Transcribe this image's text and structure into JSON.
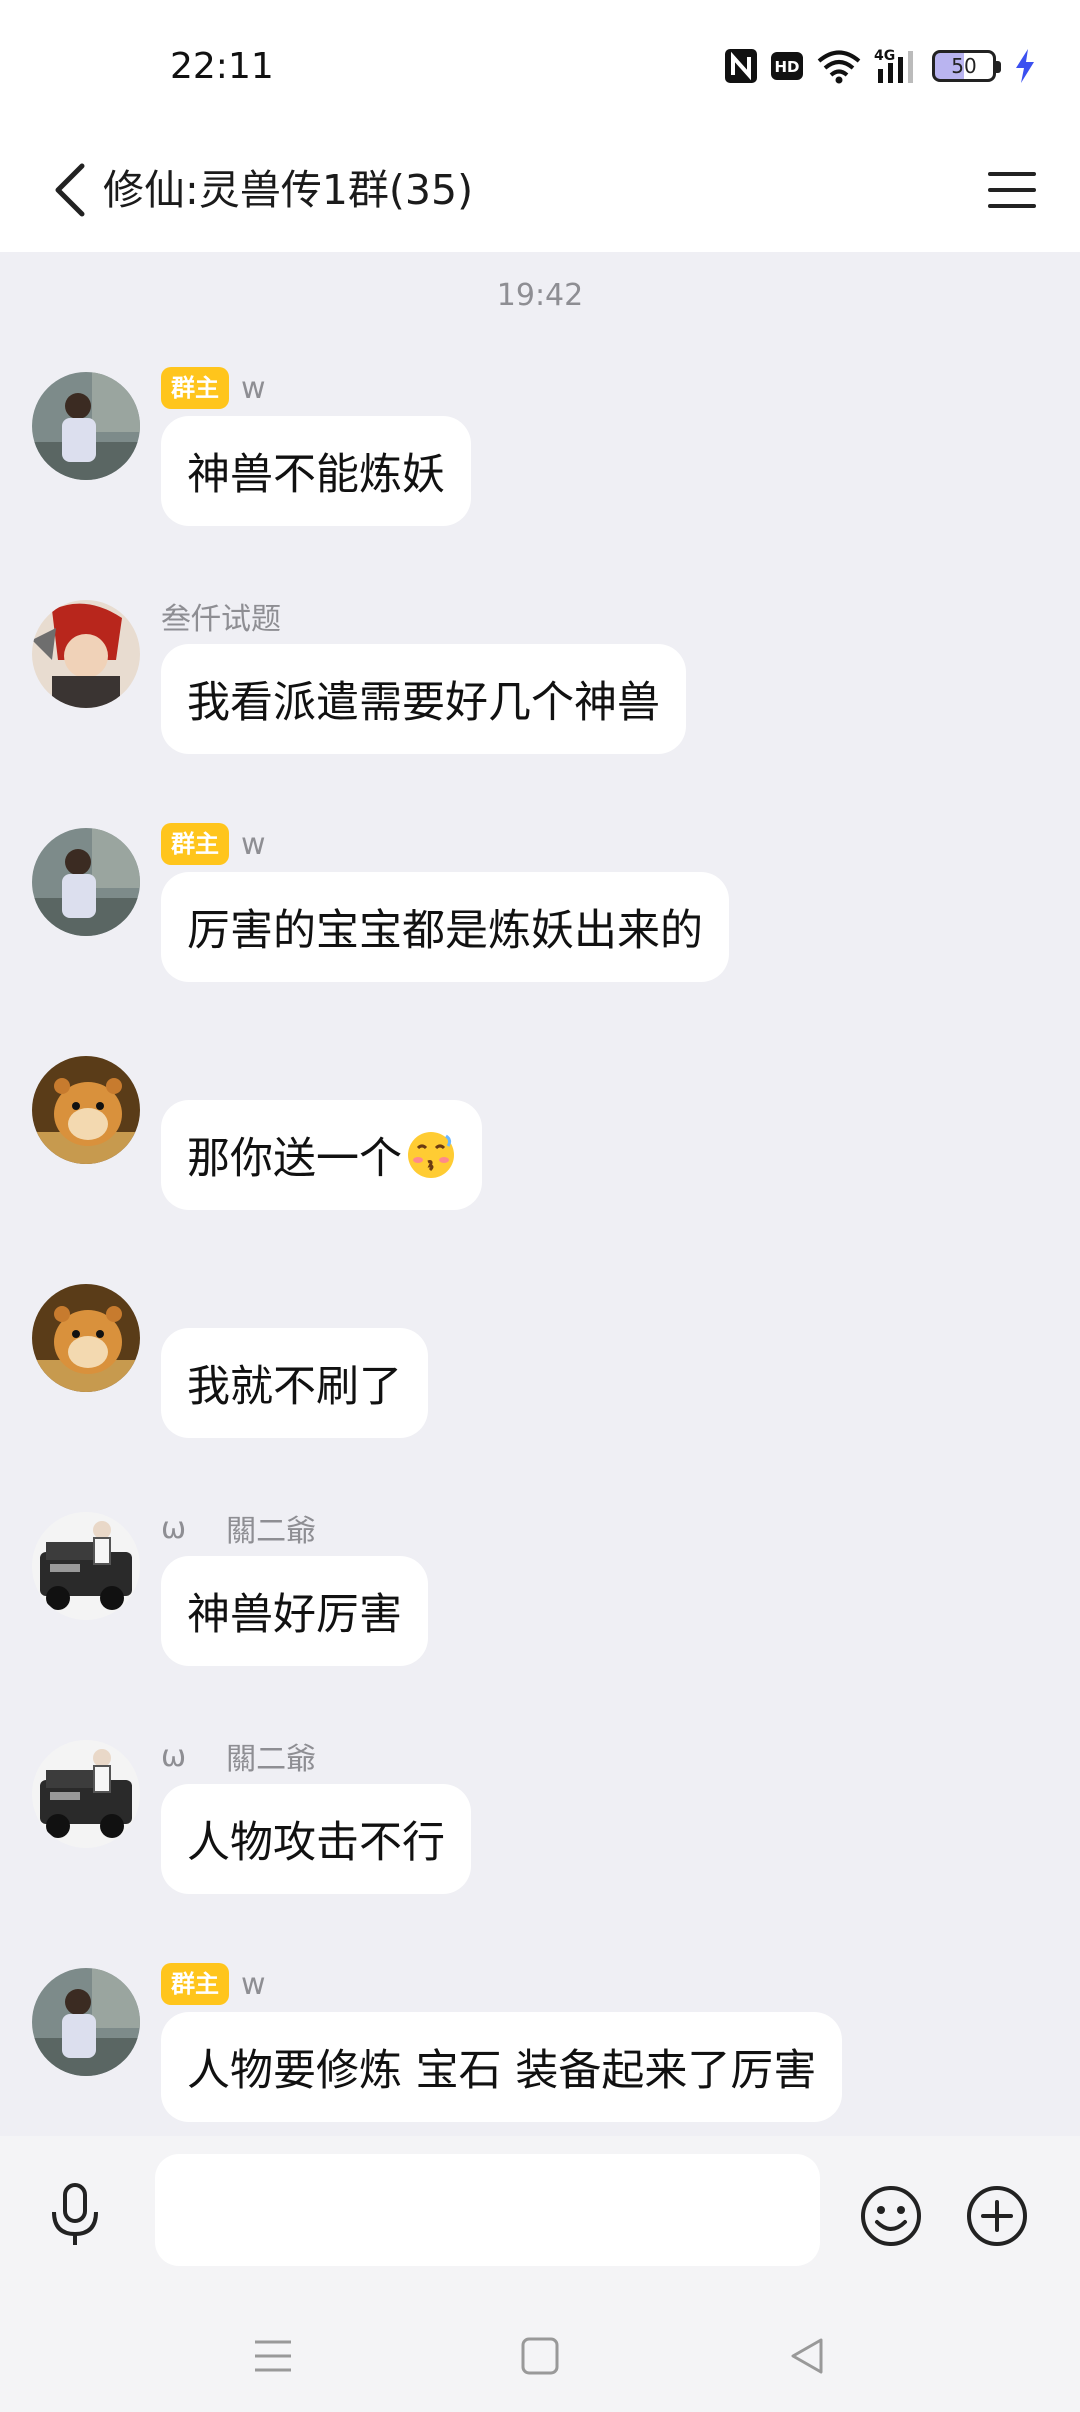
{
  "status_bar": {
    "time": "22:11",
    "hd_label": "HD",
    "network_label": "4G",
    "battery_level": "50",
    "icons": [
      "nfc-icon",
      "hd-icon",
      "wifi-icon",
      "signal-icon",
      "battery-icon",
      "charging-icon"
    ]
  },
  "header": {
    "title": "修仙:灵兽传1群(35)",
    "back_icon": "chevron-left-icon",
    "menu_icon": "hamburger-menu-icon"
  },
  "chat": {
    "time_divider": "19:42",
    "messages": [
      {
        "badge": "群主",
        "sender": "w",
        "text": "神兽不能炼妖",
        "avatar": "avatar-w"
      },
      {
        "badge": "",
        "sender": "叁仟试题",
        "text": "我看派遣需要好几个神兽",
        "avatar": "avatar-anime"
      },
      {
        "badge": "群主",
        "sender": "w",
        "text": "厉害的宝宝都是炼妖出来的",
        "avatar": "avatar-w"
      },
      {
        "badge": "",
        "sender": "",
        "text": "那你送一个",
        "emoji": "pleading-kiss-emoji",
        "avatar": "avatar-hamster"
      },
      {
        "badge": "",
        "sender": "",
        "text": "我就不刷了",
        "avatar": "avatar-hamster"
      },
      {
        "badge": "",
        "tag": "ω",
        "sender": "關二爺",
        "text": "神兽好厉害",
        "avatar": "avatar-jeep"
      },
      {
        "badge": "",
        "tag": "ω",
        "sender": "關二爺",
        "text": "人物攻击不行",
        "avatar": "avatar-jeep"
      },
      {
        "badge": "群主",
        "sender": "w",
        "text": "人物要修炼 宝石 装备起来了厉害",
        "avatar": "avatar-w"
      }
    ]
  },
  "input_bar": {
    "value": "",
    "voice_icon": "microphone-icon",
    "emoji_icon": "smiley-icon",
    "plus_icon": "plus-circle-icon"
  },
  "system_nav": {
    "icons": [
      "recent-apps-icon",
      "home-icon",
      "back-triangle-icon"
    ]
  },
  "colors": {
    "owner_badge": "#ffc51c",
    "chat_background": "#efeff4",
    "bubble": "#ffffff"
  }
}
